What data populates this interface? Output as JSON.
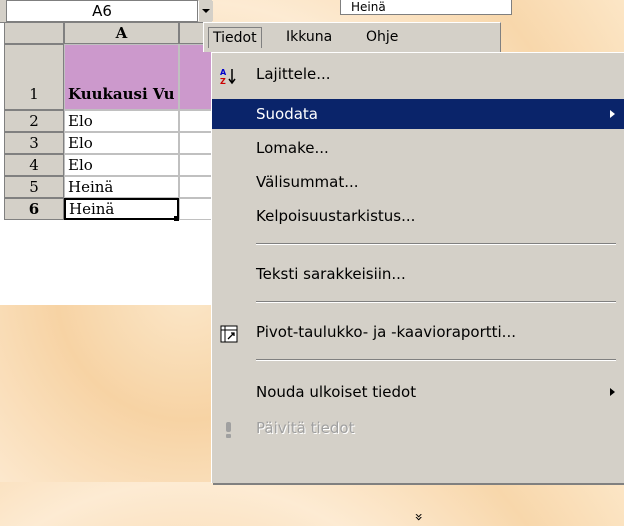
{
  "name_box": {
    "value": "A6"
  },
  "formula_bar": {
    "value": "Heinä"
  },
  "sheet": {
    "column_header": "A",
    "rows": [
      {
        "num": "1",
        "value": "Kuukausi Vu"
      },
      {
        "num": "2",
        "value": "Elo"
      },
      {
        "num": "3",
        "value": "Elo"
      },
      {
        "num": "4",
        "value": "Elo"
      },
      {
        "num": "5",
        "value": "Heinä"
      },
      {
        "num": "6",
        "value": "Heinä"
      }
    ]
  },
  "menubar": {
    "tiedot": "Tiedot",
    "ikkuna": "Ikkuna",
    "ohje": "Ohje"
  },
  "menu": {
    "lajittele": "Lajittele...",
    "suodata": "Suodata",
    "lomake": "Lomake...",
    "valisummat": "Välisummat...",
    "kelpoisuus": "Kelpoisuustarkistus...",
    "teksti": "Teksti sarakkeisiin...",
    "pivot": "Pivot-taulukko- ja -kaavioraportti...",
    "nouda": "Nouda ulkoiset tiedot",
    "paivita": "Päivitä tiedot",
    "more": "»"
  },
  "colors": {
    "highlight": "#0a246a",
    "header_fill": "#cc99cc",
    "menu_bg": "#d4d0c8"
  }
}
